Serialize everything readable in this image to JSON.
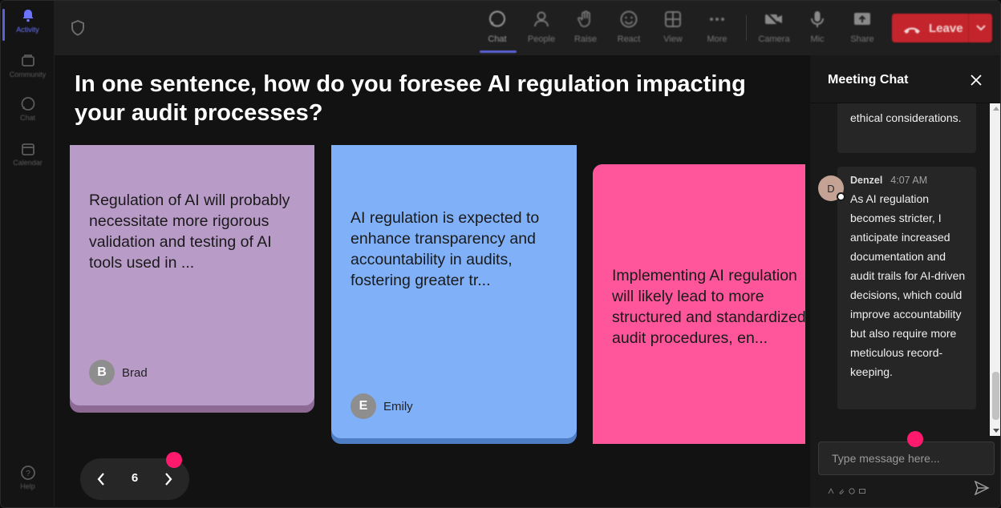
{
  "rail": {
    "items": [
      {
        "label": "Activity",
        "icon": "bell-icon"
      },
      {
        "label": "Community",
        "icon": "community-icon"
      },
      {
        "label": "Chat",
        "icon": "chat-icon"
      },
      {
        "label": "Calendar",
        "icon": "calendar-icon"
      },
      {
        "label": "Help",
        "icon": "help-icon"
      }
    ]
  },
  "toolbar": {
    "chat": "Chat",
    "people": "People",
    "raise": "Raise",
    "react": "React",
    "view": "View",
    "more": "More",
    "camera": "Camera",
    "mic": "Mic",
    "share": "Share",
    "leave": "Leave"
  },
  "question": "In one sentence, how do you foresee AI regulation impacting your audit processes?",
  "cards": [
    {
      "text": "Regulation of AI will probably necessitate more rigorous validation and testing of AI tools used in ...",
      "author": "Brad",
      "initial": "B",
      "color": "#b99bc8"
    },
    {
      "text": "AI regulation is expected to enhance transparency and accountability in audits, fostering greater tr...",
      "author": "Emily",
      "initial": "E",
      "color": "#7fb0f8"
    },
    {
      "text": "Implementing AI regulation will likely lead to more structured and standardized audit procedures, en...",
      "color": "#ff559a"
    }
  ],
  "pager": {
    "page": "6"
  },
  "chat": {
    "title": "Meeting Chat",
    "messages": [
      {
        "text": "ethical considerations."
      },
      {
        "sender": "Denzel",
        "initial": "D",
        "time": "4:07 AM",
        "text": "As AI regulation becomes stricter, I anticipate increased documentation and audit trails for AI-driven decisions, which could improve accountability but also require more meticulous record-keeping."
      }
    ],
    "placeholder": "Type message here..."
  },
  "colors": {
    "accent": "#5b61d6",
    "leave": "#c4242b",
    "notification_dot": "#ff1a6e"
  }
}
